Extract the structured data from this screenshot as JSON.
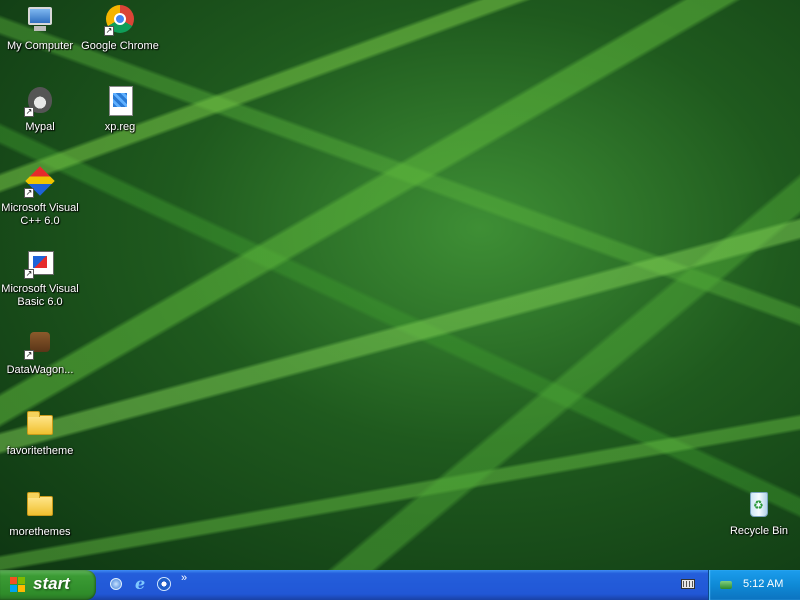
{
  "desktop": {
    "icons": [
      {
        "label": "My Computer",
        "icon": "my-computer-icon"
      },
      {
        "label": "Google Chrome",
        "icon": "chrome-icon"
      },
      {
        "label": "Mypal",
        "icon": "mypal-icon"
      },
      {
        "label": "xp.reg",
        "icon": "registry-file-icon"
      },
      {
        "label": "Microsoft Visual C++ 6.0",
        "icon": "visual-cpp-icon"
      },
      {
        "label": "Microsoft Visual Basic 6.0",
        "icon": "visual-basic-icon"
      },
      {
        "label": "DataWagon...",
        "icon": "datawagon-icon"
      },
      {
        "label": "favoritetheme",
        "icon": "folder-icon"
      },
      {
        "label": "morethemes",
        "icon": "folder-icon"
      },
      {
        "label": "Recycle Bin",
        "icon": "recycle-bin-icon"
      }
    ]
  },
  "taskbar": {
    "start_label": "start",
    "quick_launch": [
      "show-desktop-icon",
      "internet-explorer-icon",
      "media-player-icon"
    ],
    "chevron": "»",
    "clock": "5:12 AM"
  },
  "colors": {
    "taskbar_blue": "#245edb",
    "start_green": "#3b9b34",
    "tray_blue": "#0f8ad6"
  }
}
